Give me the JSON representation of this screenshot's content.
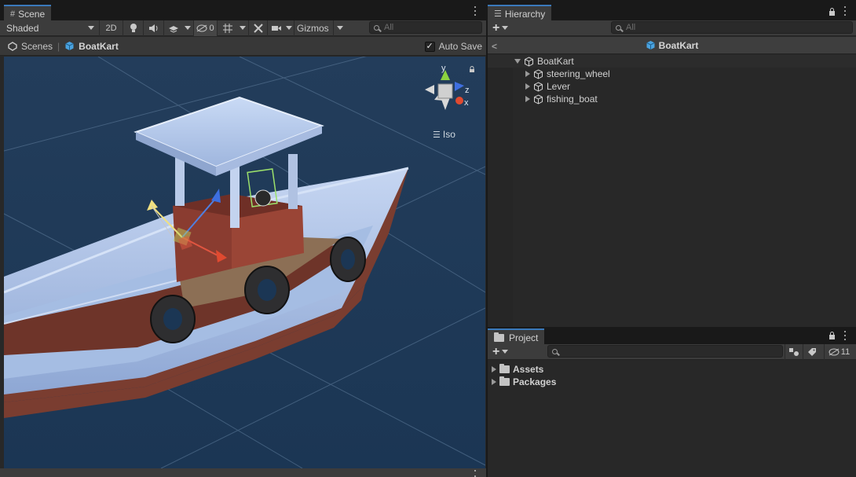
{
  "scene": {
    "tab_label": "Scene",
    "shading_mode": "Shaded",
    "toggle_2d": "2D",
    "hidden_count": "0",
    "gizmos_label": "Gizmos",
    "search_placeholder": "All",
    "breadcrumb": {
      "root": "Scenes",
      "current": "BoatKart"
    },
    "auto_save_label": "Auto Save",
    "auto_save_checked": "✓",
    "projection_label": "Iso",
    "axis_labels": {
      "y": "y",
      "z": "z",
      "x": "x"
    }
  },
  "hierarchy": {
    "tab_label": "Hierarchy",
    "search_placeholder": "All",
    "scene_name": "BoatKart",
    "root_object": "BoatKart",
    "children": [
      "steering_wheel",
      "Lever",
      "fishing_boat"
    ]
  },
  "project": {
    "tab_label": "Project",
    "hidden_count": "11",
    "folders": [
      "Assets",
      "Packages"
    ]
  },
  "colors": {
    "accent": "#3a79bb",
    "viewport_bg": "#1f3a58",
    "boat_hull": "#9fb8e0",
    "boat_wood": "#7a3d30"
  },
  "icons": {
    "scene_tab": "hash-icon",
    "hierarchy_tab": "list-icon",
    "project_tab": "folder-icon",
    "game_object": "cube-icon"
  }
}
